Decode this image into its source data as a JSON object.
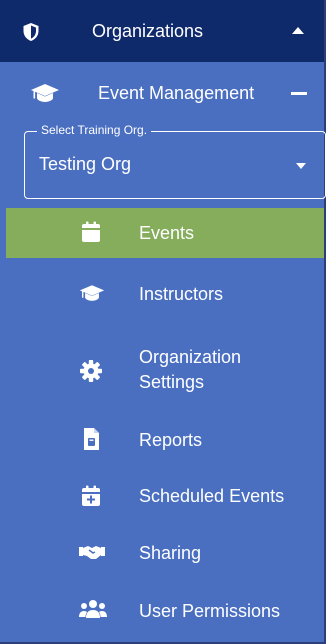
{
  "organizations": {
    "label": "Organizations"
  },
  "event_management": {
    "label": "Event Management"
  },
  "training_org_select": {
    "legend": "Select Training Org.",
    "value": "Testing Org"
  },
  "nav": {
    "items": [
      {
        "label": "Events",
        "icon": "calendar-icon",
        "active": true
      },
      {
        "label": "Instructors",
        "icon": "graduation-cap-icon"
      },
      {
        "label": "Organization\nSettings",
        "icon": "gear-icon"
      },
      {
        "label": "Reports",
        "icon": "report-document-icon"
      },
      {
        "label": "Scheduled Events",
        "icon": "calendar-plus-icon"
      },
      {
        "label": "Sharing",
        "icon": "handshake-icon"
      },
      {
        "label": "User Permissions",
        "icon": "users-icon"
      }
    ]
  },
  "colors": {
    "header_bg": "#0f2a6b",
    "panel_bg": "#4a6fc1",
    "active_bg": "#86ad5c",
    "text": "#ffffff"
  }
}
